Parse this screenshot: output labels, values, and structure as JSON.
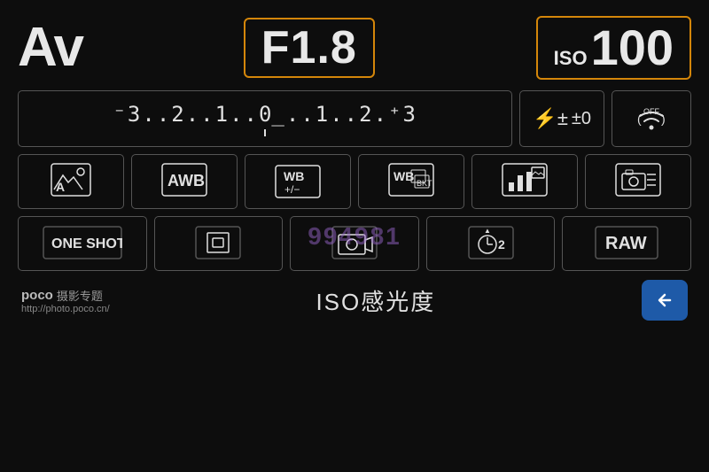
{
  "screen": {
    "background": "#0d0d0d"
  },
  "top": {
    "av_label": "Av",
    "aperture": "F1.8",
    "iso_prefix": "ISO",
    "iso_value": "100"
  },
  "exposure": {
    "scale": "⁻3..2..1..0..1..2.⁺3",
    "scale_display": "-3..2..1..0..1..2.+3",
    "flash_label": "±0",
    "wifi_text": "OFF"
  },
  "settings_row": {
    "scene": "A",
    "wb": "AWB",
    "wb_adj": "WB\n+/-",
    "wb_shift": "WB",
    "picture_style": "",
    "camera": ""
  },
  "bottom_row": {
    "af_mode": "ONE SHOT",
    "af_select": "",
    "live_view": "",
    "self_timer": "2",
    "image_quality": "RAW"
  },
  "footer": {
    "poco_label": "poco",
    "poco_subtitle": "摄影专题",
    "poco_url": "http://photo.poco.cn/",
    "iso_label": "ISO感光度"
  },
  "watermark": {
    "text": "994981"
  }
}
